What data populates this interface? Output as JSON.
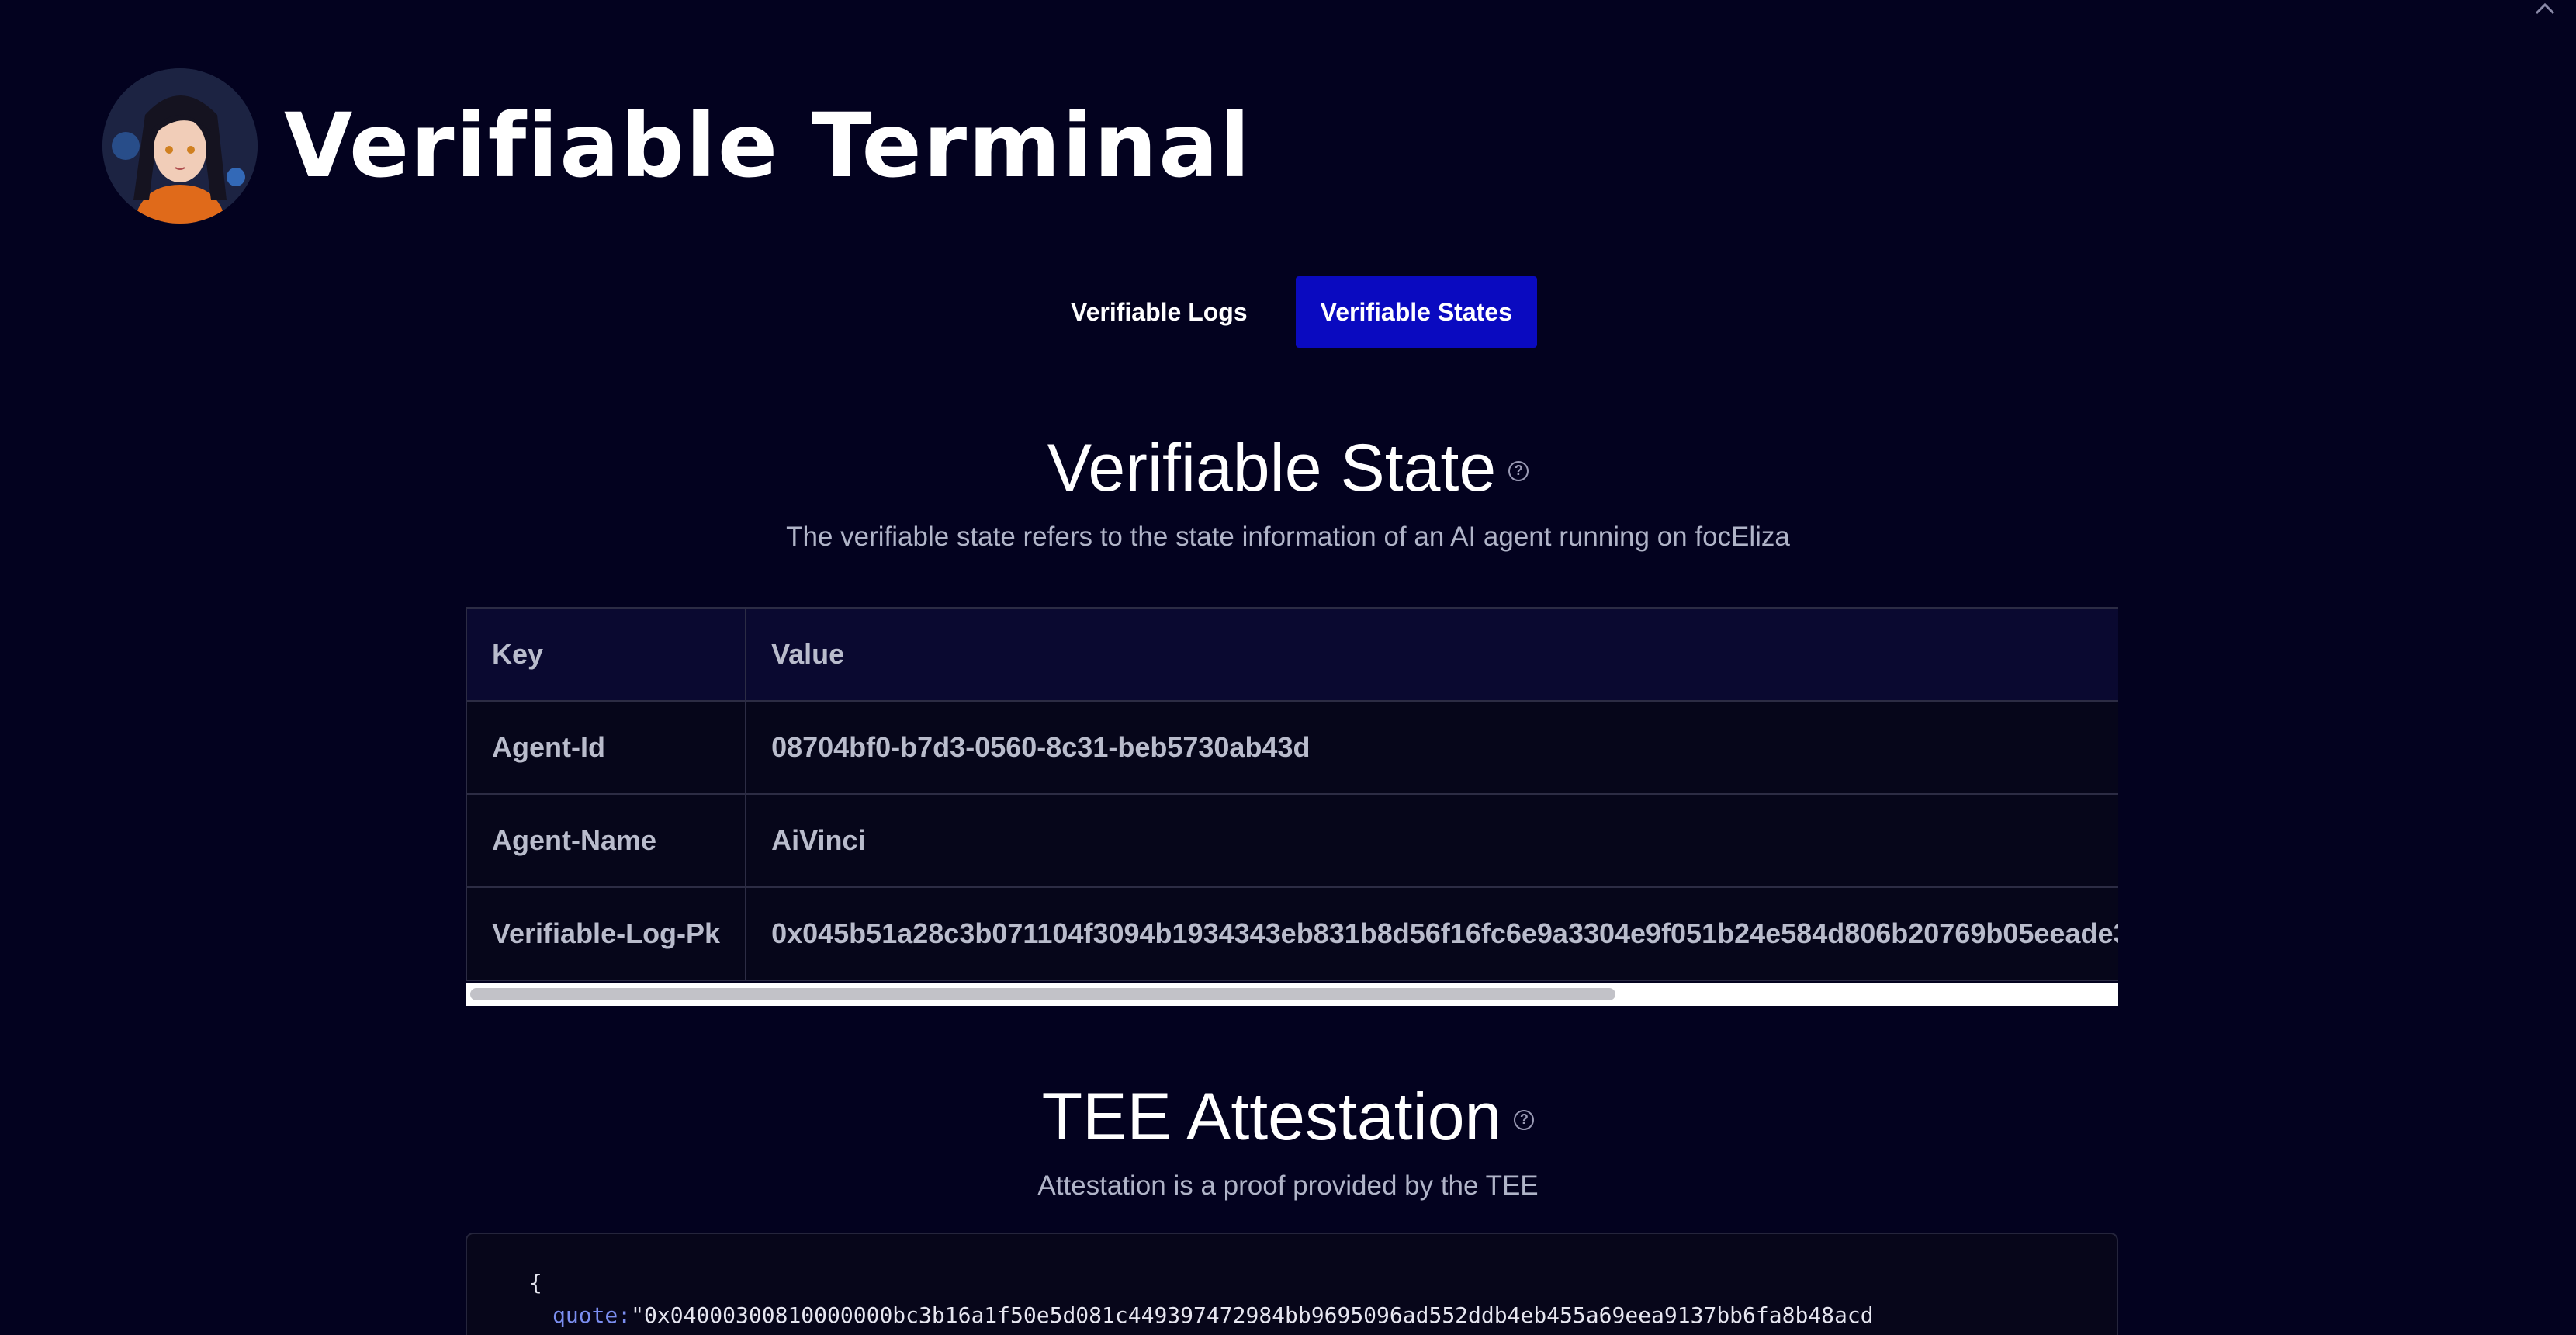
{
  "header": {
    "title": "Verifiable Terminal"
  },
  "tabs": [
    {
      "label": "Verifiable Logs",
      "active": false
    },
    {
      "label": "Verifiable States",
      "active": true
    }
  ],
  "state_section": {
    "title": "Verifiable State",
    "subtitle": "The verifiable state refers to the state information of an AI agent running on focEliza"
  },
  "state_table": {
    "headers": [
      "Key",
      "Value"
    ],
    "rows": [
      {
        "key": "Agent-Id",
        "value": "08704bf0-b7d3-0560-8c31-beb5730ab43d"
      },
      {
        "key": "Agent-Name",
        "value": "AiVinci"
      },
      {
        "key": "Verifiable-Log-Pk",
        "value": "0x045b51a28c3b071104f3094b1934343eb831b8d56f16fc6e9a3304e9f051b24e584d806b20769b05eeade3"
      }
    ]
  },
  "attestation_section": {
    "title": "TEE Attestation",
    "subtitle": "Attestation is a proof provided by the TEE"
  },
  "attestation_code": {
    "open_brace": "{",
    "quote_key": "quote:",
    "quote_value": "\"0x04000300810000000bc3b16a1f50e5d081c449397472984bb9695096ad552ddb4eb455a69eea9137bb6fa8b48acd"
  },
  "colors": {
    "background": "#03021f",
    "active_tab": "#0a0ac0",
    "code_key": "#7b8ef0"
  }
}
